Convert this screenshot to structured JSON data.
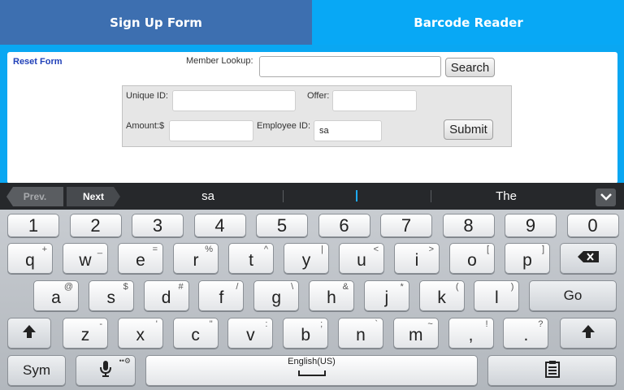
{
  "tabs": [
    {
      "label": "Sign Up Form"
    },
    {
      "label": "Barcode Reader"
    }
  ],
  "form": {
    "reset_label": "Reset Form",
    "member_lookup_label": "Member Lookup:",
    "member_lookup_value": "",
    "search_label": "Search",
    "unique_id_label": "Unique ID:",
    "unique_id_value": "",
    "offer_label": "Offer:",
    "offer_value": "",
    "amount_label": "Amount:$",
    "amount_value": "",
    "employee_id_label": "Employee ID:",
    "employee_id_value": "sa",
    "submit_label": "Submit"
  },
  "suggestions": {
    "prev_label": "Prev.",
    "next_label": "Next",
    "items": [
      "sa",
      "",
      "The"
    ]
  },
  "keyboard": {
    "numbers": [
      "1",
      "2",
      "3",
      "4",
      "5",
      "6",
      "7",
      "8",
      "9",
      "0"
    ],
    "row1": [
      {
        "main": "q",
        "alt": "+"
      },
      {
        "main": "w",
        "alt": "_"
      },
      {
        "main": "e",
        "alt": "="
      },
      {
        "main": "r",
        "alt": "%"
      },
      {
        "main": "t",
        "alt": "^"
      },
      {
        "main": "y",
        "alt": "|"
      },
      {
        "main": "u",
        "alt": "<"
      },
      {
        "main": "i",
        "alt": ">"
      },
      {
        "main": "o",
        "alt": "["
      },
      {
        "main": "p",
        "alt": "]"
      }
    ],
    "row2": [
      {
        "main": "a",
        "alt": "@"
      },
      {
        "main": "s",
        "alt": "$"
      },
      {
        "main": "d",
        "alt": "#"
      },
      {
        "main": "f",
        "alt": "/"
      },
      {
        "main": "g",
        "alt": "\\"
      },
      {
        "main": "h",
        "alt": "&"
      },
      {
        "main": "j",
        "alt": "*"
      },
      {
        "main": "k",
        "alt": "("
      },
      {
        "main": "l",
        "alt": ")"
      }
    ],
    "row3": [
      {
        "main": "z",
        "alt": "-"
      },
      {
        "main": "x",
        "alt": "'"
      },
      {
        "main": "c",
        "alt": "\""
      },
      {
        "main": "v",
        "alt": ":"
      },
      {
        "main": "b",
        "alt": ";"
      },
      {
        "main": "n",
        "alt": "`"
      },
      {
        "main": "m",
        "alt": "~"
      },
      {
        "main": ",",
        "alt": "!"
      },
      {
        "main": ".",
        "alt": "?"
      }
    ],
    "go_label": "Go",
    "sym_label": "Sym",
    "space_label": "English(US)",
    "icons": {
      "backspace": "backspace-icon",
      "shift": "shift-icon",
      "mic": "microphone-icon",
      "clipboard": "clipboard-icon",
      "collapse": "chevron-down-icon"
    }
  },
  "colors": {
    "tab_active": "#08a8f5",
    "tab_inactive": "#3d6fb0",
    "link": "#1f3fb8",
    "cursor": "#1ea9f0"
  }
}
